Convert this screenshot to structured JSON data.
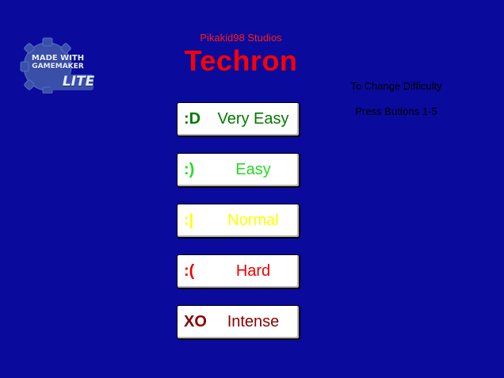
{
  "logo": {
    "line1": "MADE WITH",
    "line2": "GAMEMAKER",
    "line3": "LITE"
  },
  "header": {
    "studio": "Pikakid98 Studios",
    "title": "Techron"
  },
  "help": {
    "line1": "To Change Difficulty",
    "line2": "Press Buttons 1-5"
  },
  "difficulties": [
    {
      "face": ":D",
      "label": "Very Easy",
      "color": "#007a00"
    },
    {
      "face": ":)",
      "label": "Easy",
      "color": "#22dd22"
    },
    {
      "face": ":|",
      "label": "Normal",
      "color": "#ffff00"
    },
    {
      "face": ":(",
      "label": "Hard",
      "color": "#ee0000"
    },
    {
      "face": "XO",
      "label": "Intense",
      "color": "#880000"
    }
  ],
  "colors": {
    "background": "#0a0a9c",
    "title": "#ff0000"
  }
}
